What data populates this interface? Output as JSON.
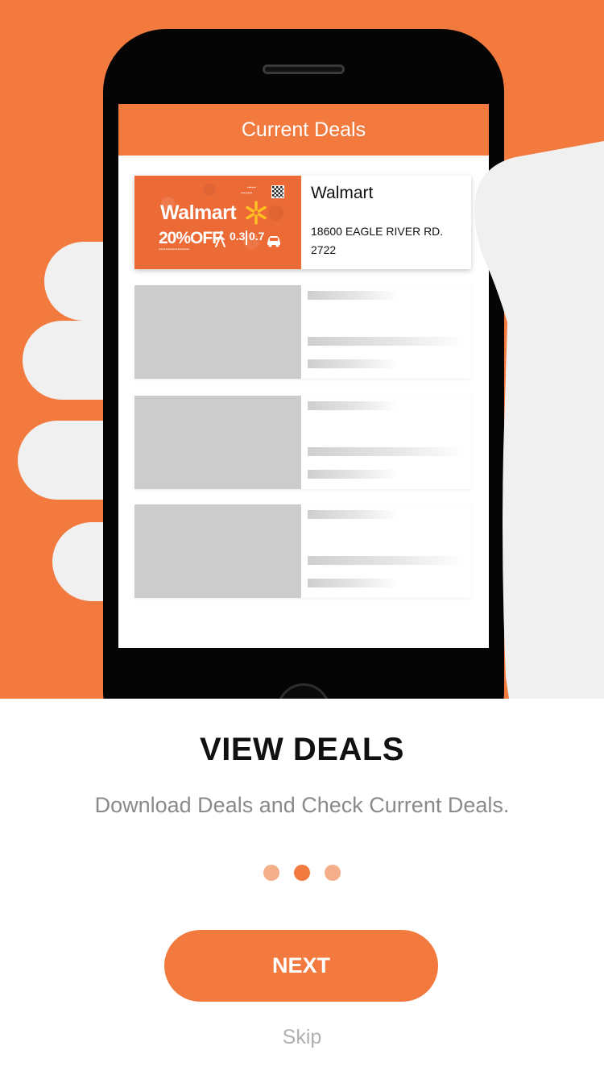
{
  "colors": {
    "brand_orange": "#F27A3E",
    "dot_inactive": "#F5AE8A",
    "hand": "#F0F0F0",
    "placeholder_gray": "#CCCCCC"
  },
  "illustration": {
    "screen_title": "Current Deals",
    "featured_deal": {
      "name": "Walmart",
      "address": "18600 EAGLE RIVER RD. 2722",
      "ad": {
        "brand": "Walmart",
        "discount": "20%OFF",
        "distance_walk": "0.3",
        "distance_drive": "0.7"
      }
    },
    "placeholder_count": 3
  },
  "onboarding": {
    "title": "VIEW DEALS",
    "subtitle": "Download Deals and Check Current Deals.",
    "page_total": 3,
    "current_page": 2,
    "next_label": "NEXT",
    "skip_label": "Skip"
  }
}
